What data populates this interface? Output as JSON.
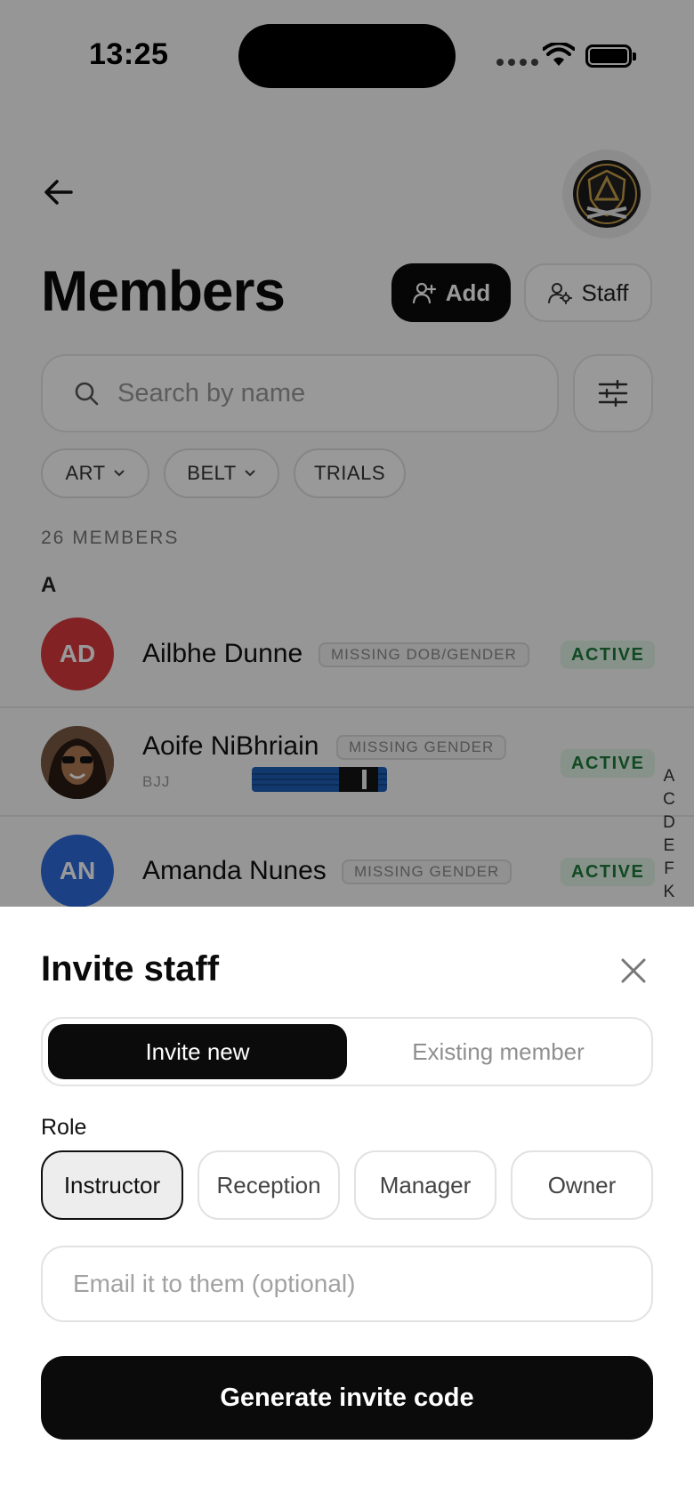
{
  "status_bar": {
    "time": "13:25"
  },
  "header": {
    "title": "Members",
    "add_label": "Add",
    "staff_label": "Staff"
  },
  "search": {
    "placeholder": "Search by name"
  },
  "filters": [
    {
      "label": "ART",
      "has_dropdown": true
    },
    {
      "label": "BELT",
      "has_dropdown": true
    },
    {
      "label": "TRIALS",
      "has_dropdown": false
    }
  ],
  "list": {
    "count_label": "26 MEMBERS",
    "section_letter": "A",
    "members": [
      {
        "initials": "AD",
        "name": "Ailbhe Dunne",
        "warning": "MISSING DOB/GENDER",
        "status": "ACTIVE",
        "avatar_color": "#d93a3c"
      },
      {
        "initials": "",
        "name": "Aoife NiBhriain",
        "warning": "MISSING GENDER",
        "status": "ACTIVE",
        "art": "BJJ",
        "belt_color": "#1f5fb8",
        "photo": true
      },
      {
        "initials": "AN",
        "name": "Amanda Nunes",
        "warning": "MISSING GENDER",
        "status": "ACTIVE",
        "avatar_color": "#2f6bdc"
      }
    ],
    "alphabet_index": [
      "A",
      "C",
      "D",
      "E",
      "F",
      "K"
    ]
  },
  "sheet": {
    "title": "Invite staff",
    "tabs": {
      "active": "Invite new",
      "inactive": "Existing member"
    },
    "role_label": "Role",
    "roles": [
      "Instructor",
      "Reception",
      "Manager",
      "Owner"
    ],
    "selected_role": "Instructor",
    "email_placeholder": "Email it to them (optional)",
    "cta_label": "Generate invite code"
  },
  "colors": {
    "accent": "#0b0b0b",
    "active_bg": "#e2f4e6",
    "active_text": "#1c7a3a"
  }
}
